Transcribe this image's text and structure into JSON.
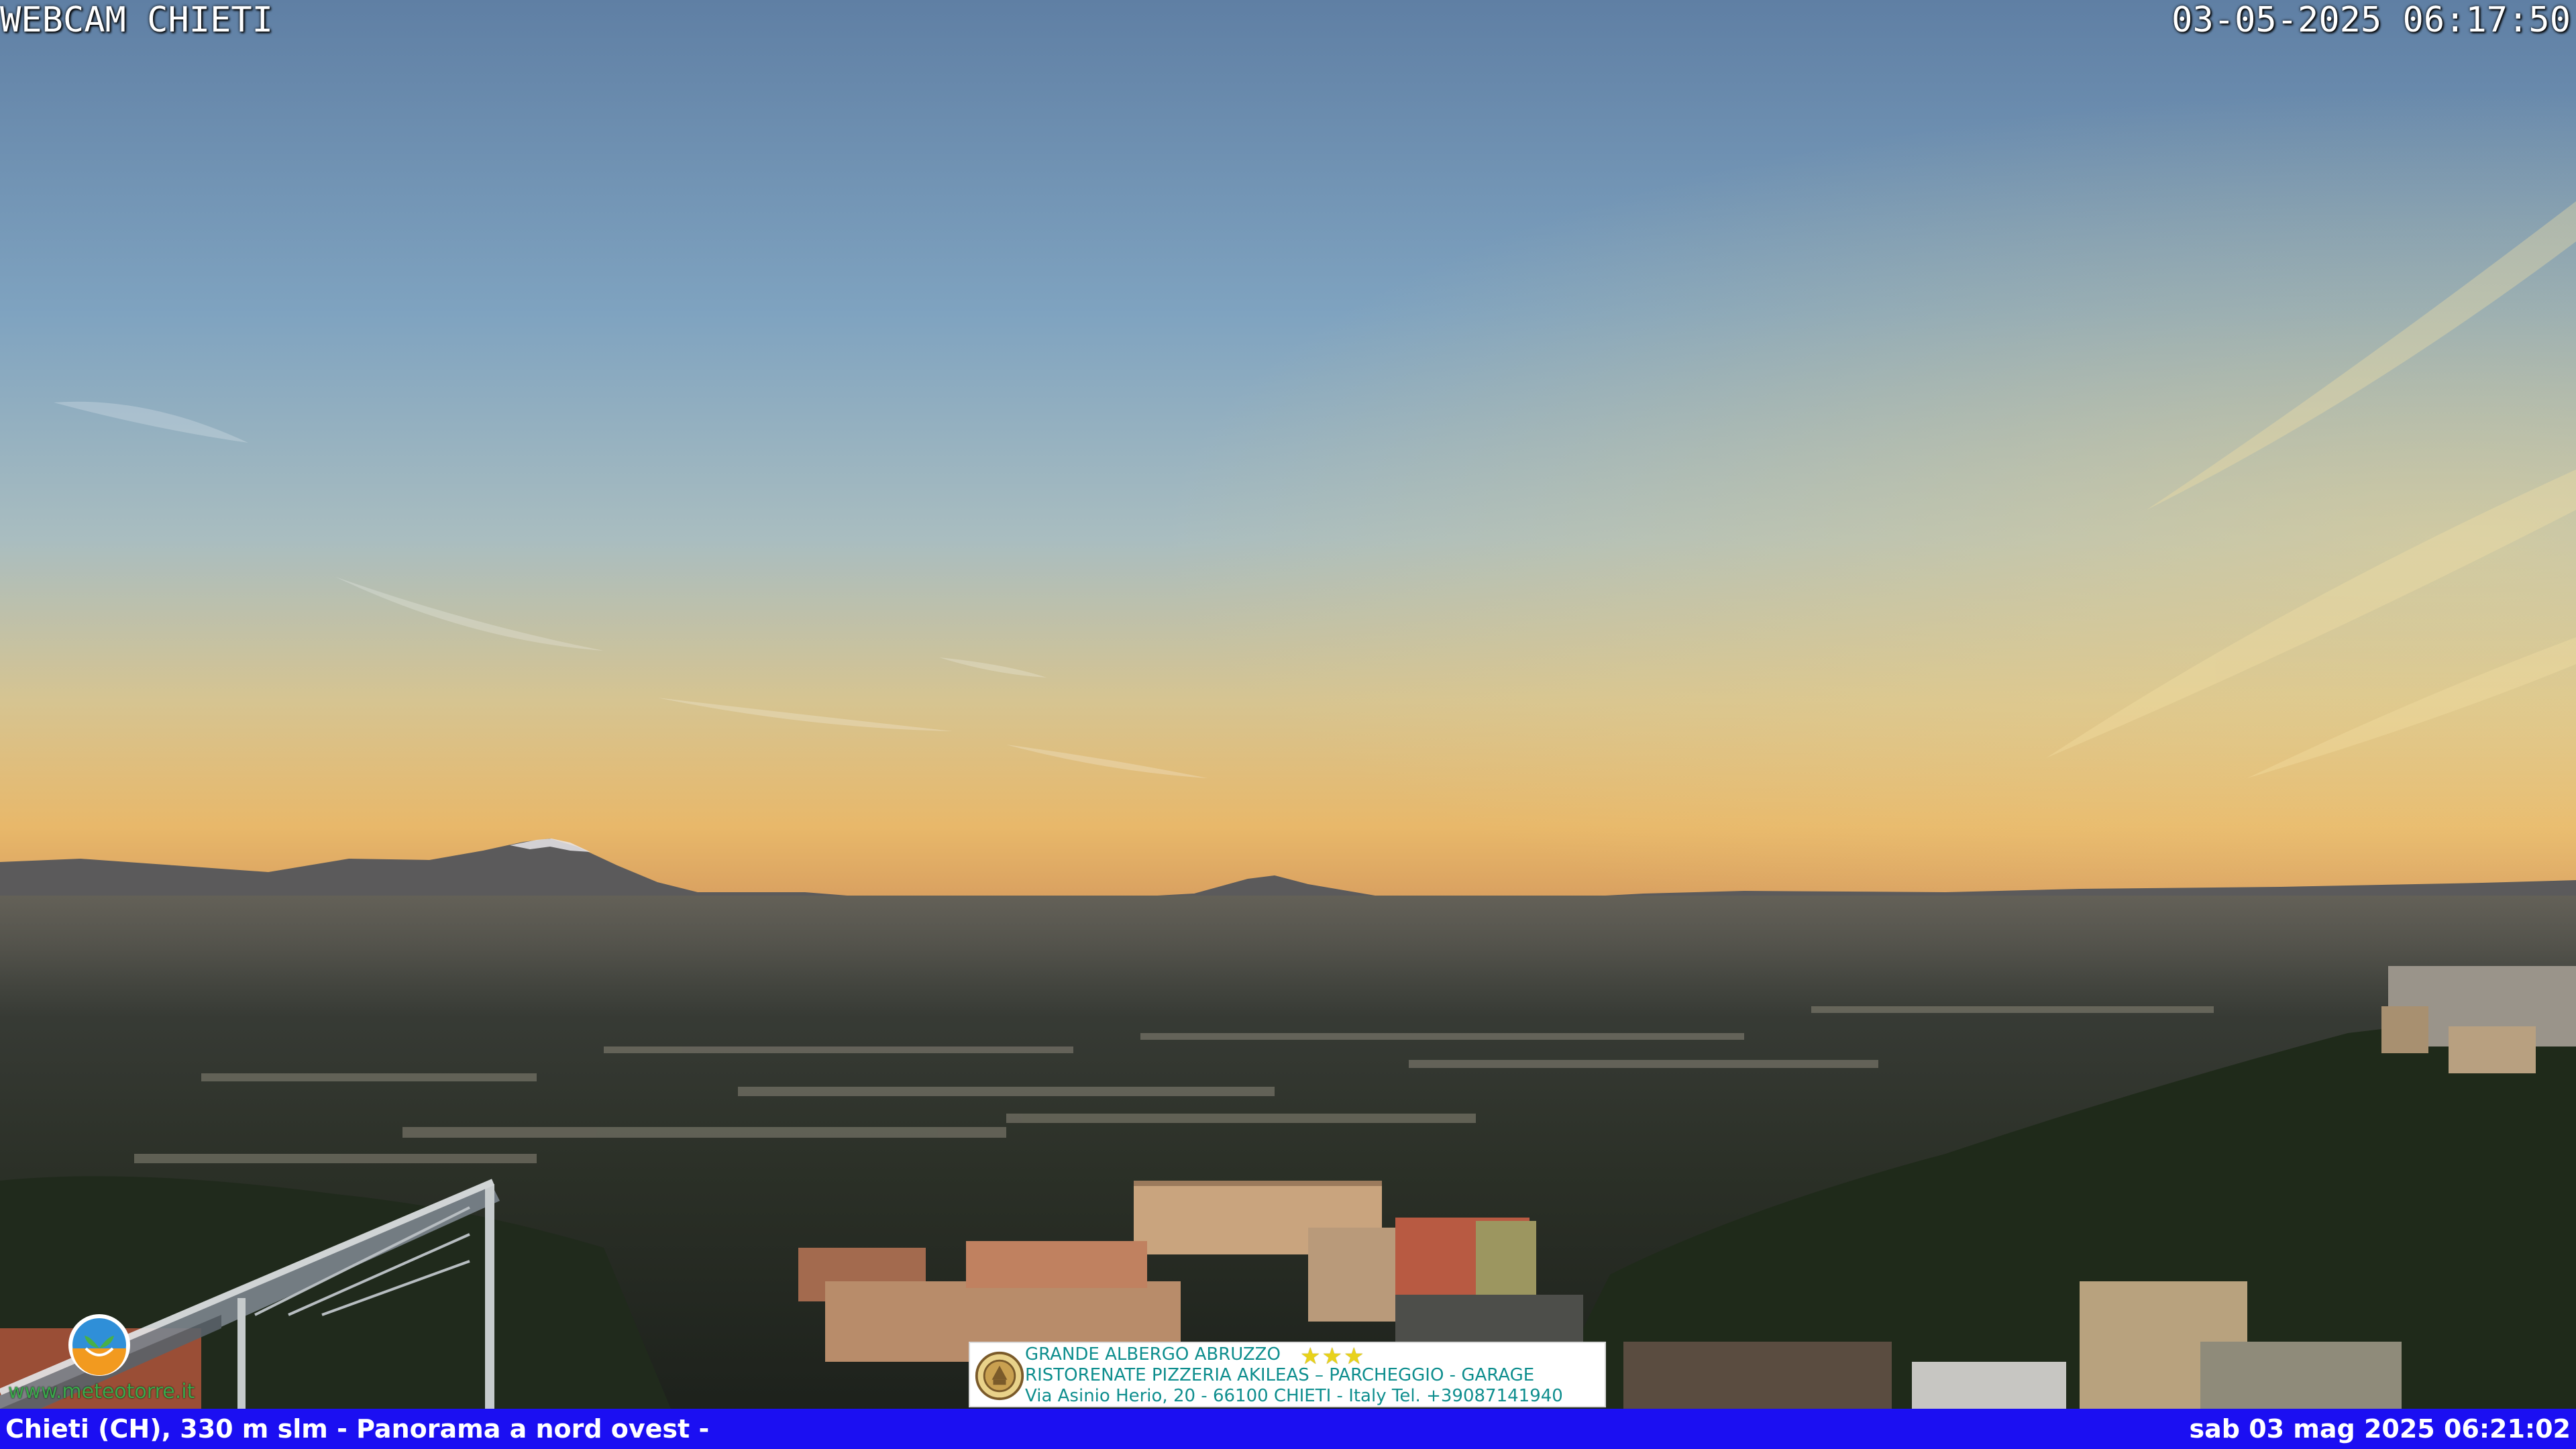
{
  "camera": {
    "title": "WEBCAM CHIETI",
    "timestamp": "03-05-2025 06:17:50"
  },
  "bottom_bar": {
    "caption": "Chieti (CH), 330 m slm - Panorama a nord ovest -",
    "datetime": "sab 03 mag 2025 06:21:02"
  },
  "ad": {
    "line1": "GRANDE ALBERGO ABRUZZO",
    "stars": "★★★",
    "line2": "RISTORENATE PIZZERIA AKILEAS – PARCHEGGIO - GARAGE",
    "line3": "Via Asinio Herio, 20 - 66100 CHIETI - Italy Tel. +39087141940"
  },
  "watermark": {
    "url": "www.meteotorre.it"
  },
  "colors": {
    "sky_top": "#5f7fa4",
    "sky_horizon": "#e8b86a",
    "bottom_bar": "#1b0ff2",
    "ad_text": "#0e8e8e"
  }
}
